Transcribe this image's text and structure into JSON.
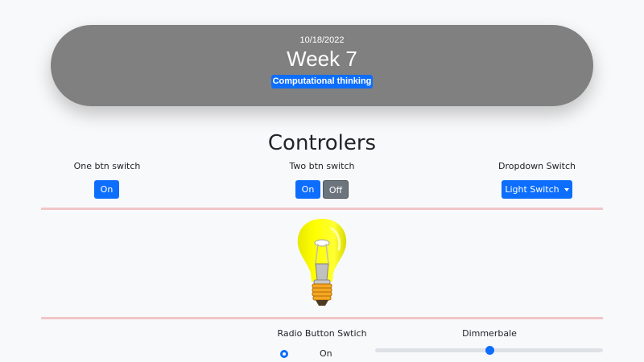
{
  "header": {
    "date": "10/18/2022",
    "title": "Week 7",
    "badge": "Computational thinking"
  },
  "controls": {
    "title": "Controlers",
    "one_btn": {
      "label": "One btn switch",
      "on_label": "On"
    },
    "two_btn": {
      "label": "Two btn switch",
      "on_label": "On",
      "off_label": "Off"
    },
    "dropdown": {
      "label": "Dropdown Switch",
      "button_label": "Light Switch"
    }
  },
  "bulb": {
    "state": "on",
    "icon": "light-bulb-icon"
  },
  "radio": {
    "label": "Radio Button Swtich",
    "option_label": "On",
    "selected": true
  },
  "dimmer": {
    "label": "Dimmerbale",
    "value": 0.5
  },
  "colors": {
    "primary": "#0d6efd",
    "secondary": "#6c757d",
    "header_bg": "#808080",
    "divider": "#f1c6c8",
    "bulb_glass": "#ffff00"
  }
}
